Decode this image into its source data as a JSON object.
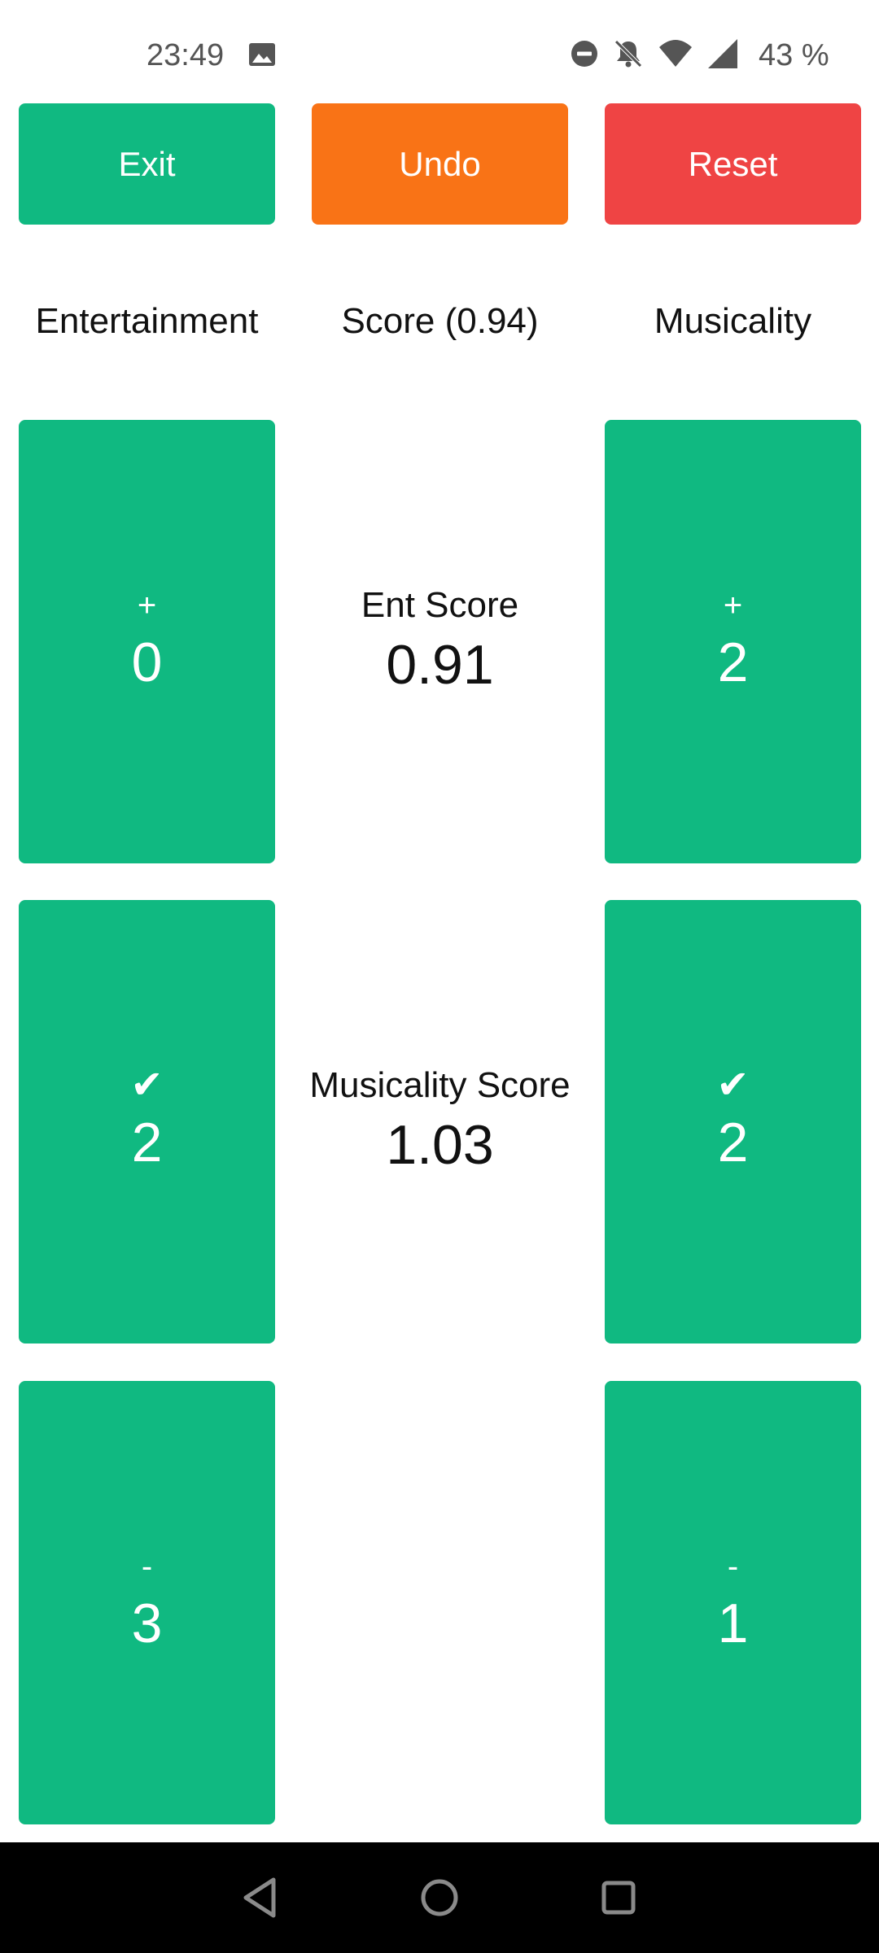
{
  "status_bar": {
    "time": "23:49",
    "battery": "43 %",
    "icons": [
      "image-icon",
      "dnd-icon",
      "bell-off-icon",
      "wifi-icon",
      "signal-icon"
    ]
  },
  "toolbar": {
    "exit_label": "Exit",
    "undo_label": "Undo",
    "reset_label": "Reset"
  },
  "headers": {
    "entertainment": "Entertainment",
    "score": "Score (0.94)",
    "musicality": "Musicality"
  },
  "entertainment": {
    "plus_symbol": "+",
    "plus_count": "0",
    "check_symbol": "✔",
    "check_count": "2",
    "minus_symbol": "-",
    "minus_count": "3"
  },
  "musicality": {
    "plus_symbol": "+",
    "plus_count": "2",
    "check_symbol": "✔",
    "check_count": "2",
    "minus_symbol": "-",
    "minus_count": "1"
  },
  "scores": {
    "ent_label": "Ent Score",
    "ent_value": "0.91",
    "mus_label": "Musicality Score",
    "mus_value": "1.03"
  },
  "colors": {
    "green": "#10b981",
    "orange": "#f97316",
    "red": "#ef4444"
  }
}
